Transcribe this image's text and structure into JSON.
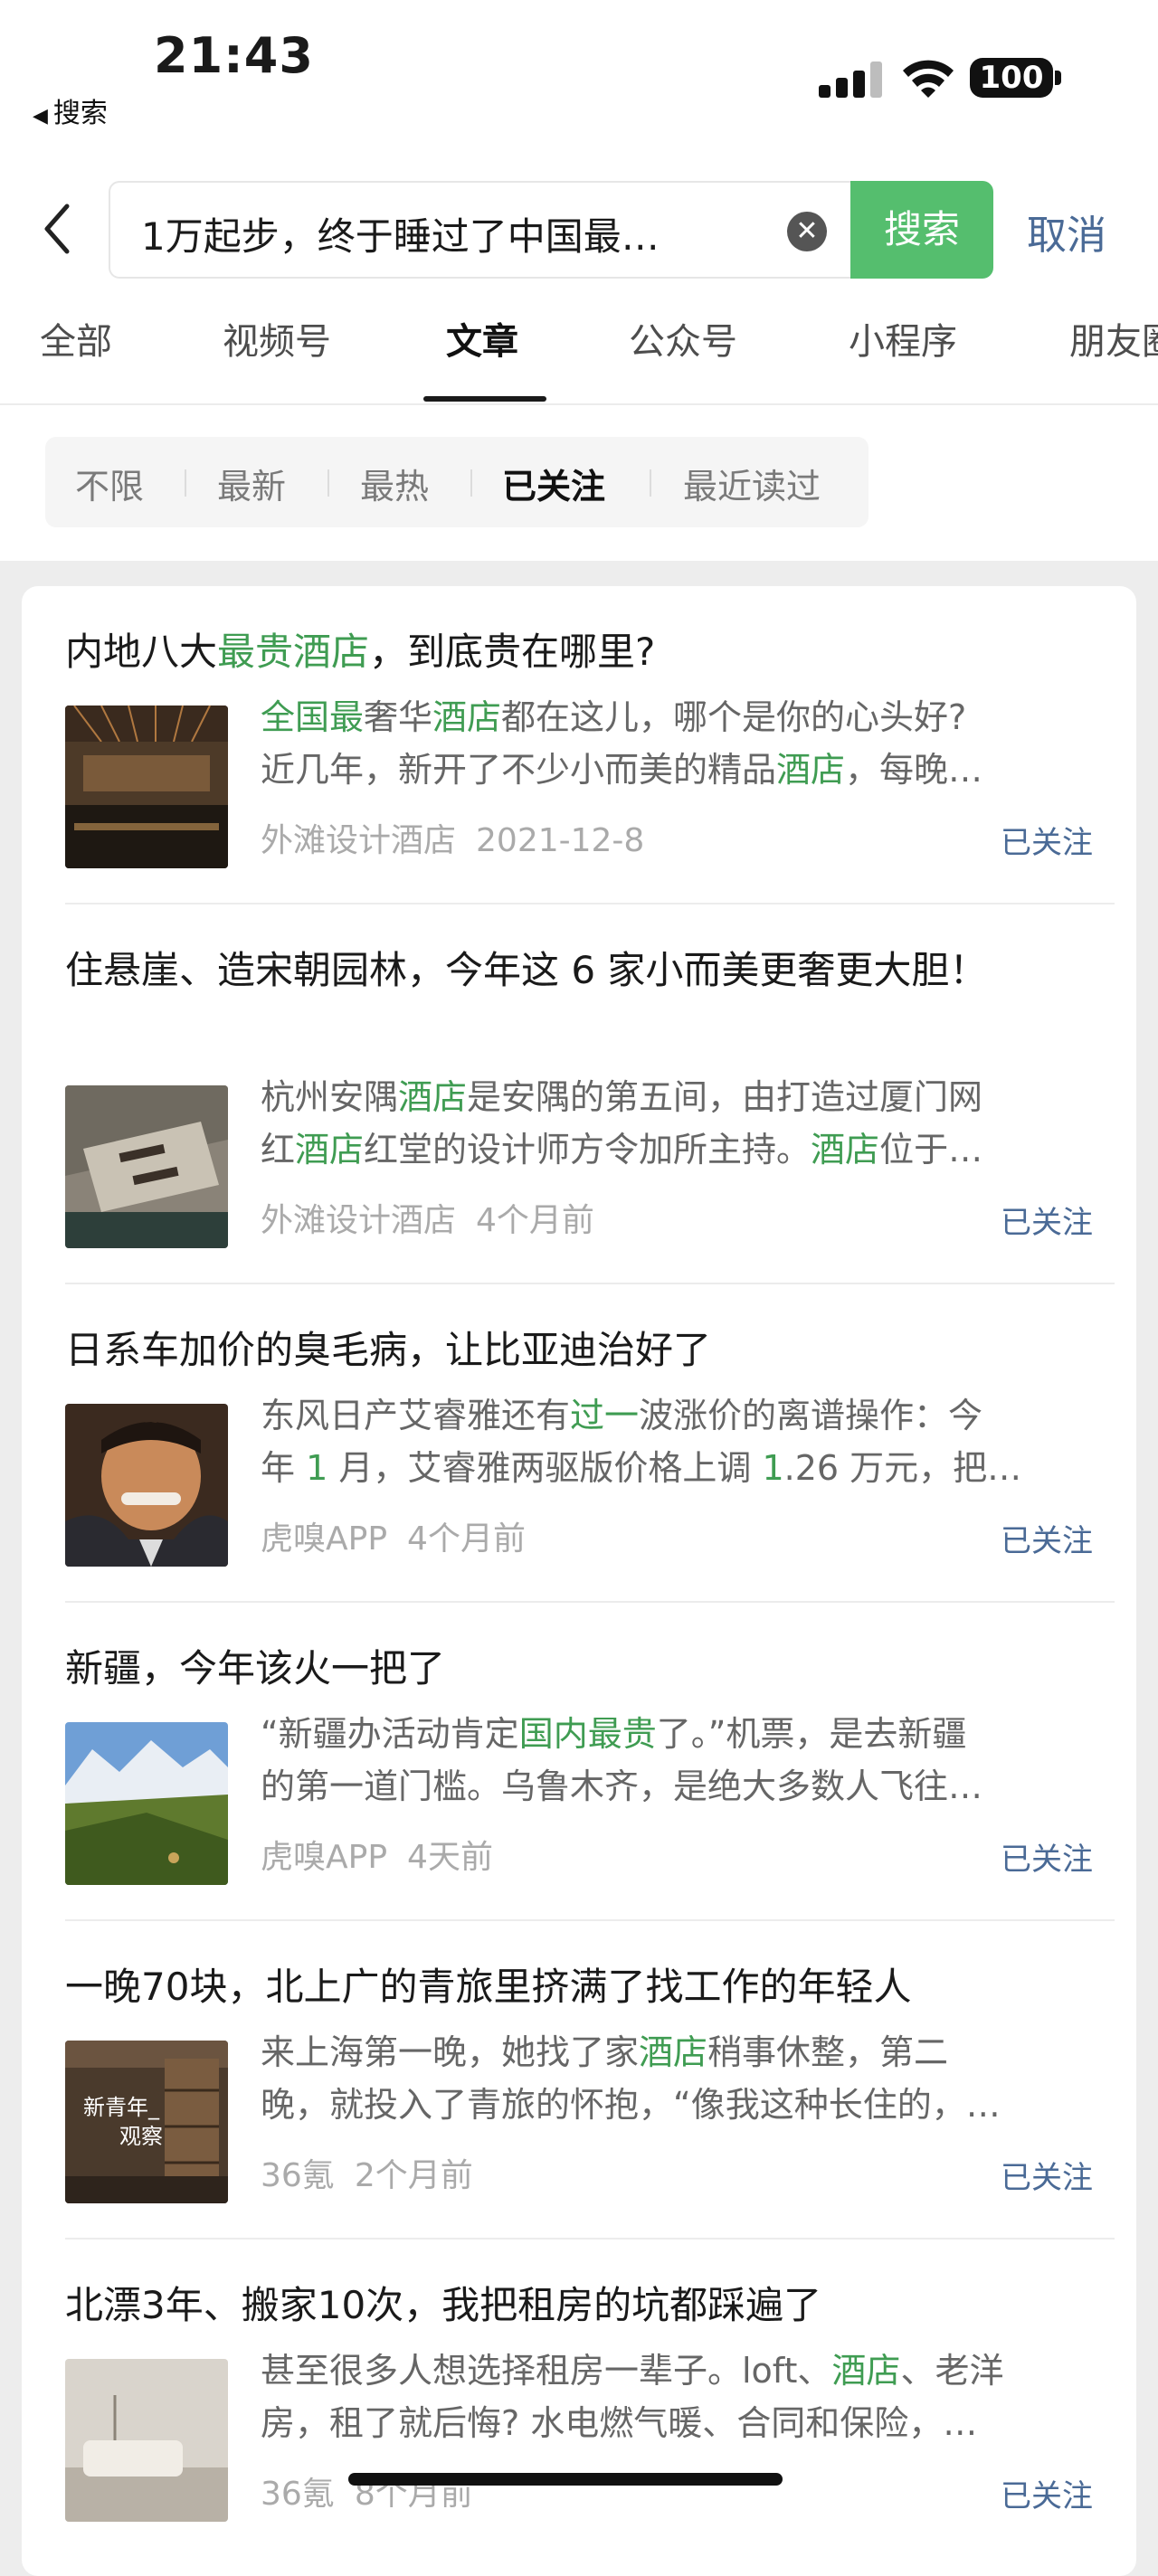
{
  "status": {
    "time": "21:43",
    "back_app": "搜索",
    "battery": "100"
  },
  "search": {
    "query": "1万起步，终于睡过了中国最…",
    "button": "搜索",
    "cancel": "取消"
  },
  "tabs": [
    "全部",
    "视频号",
    "文章",
    "公众号",
    "小程序",
    "朋友圈"
  ],
  "active_tab": "文章",
  "filters": [
    "不限",
    "最新",
    "最热",
    "已关注",
    "最近读过"
  ],
  "active_filter": "已关注",
  "highlight_color": "#3f9c52",
  "results": [
    {
      "title_parts": [
        [
          "内地八大",
          false
        ],
        [
          "最贵酒店",
          true
        ],
        [
          "，到底贵在哪里?",
          false
        ]
      ],
      "desc_lines": [
        [
          [
            "全国最",
            true
          ],
          [
            "奢华",
            false
          ],
          [
            "酒店",
            true
          ],
          [
            "都在这儿，哪个是你的心头好?",
            false
          ]
        ],
        [
          [
            "近几年，新开了不少小而美的精品",
            false
          ],
          [
            "酒店",
            true
          ],
          [
            "，每晚…",
            false
          ]
        ]
      ],
      "source": "外滩设计酒店",
      "date": "2021-12-8",
      "follow": "已关注"
    },
    {
      "title_parts": [
        [
          "住悬崖、造宋朝园林，今年这 6 家小而美更奢更大胆！",
          false
        ]
      ],
      "desc_lines": [
        [
          [
            "杭州安隅",
            false
          ],
          [
            "酒店",
            true
          ],
          [
            "是安隅的第五间，由打造过厦门网",
            false
          ]
        ],
        [
          [
            "红",
            false
          ],
          [
            "酒店",
            true
          ],
          [
            "红堂的设计师方令加所主持。",
            false
          ],
          [
            "酒店",
            true
          ],
          [
            "位于…",
            false
          ]
        ]
      ],
      "source": "外滩设计酒店",
      "date": "4个月前",
      "follow": "已关注"
    },
    {
      "title_parts": [
        [
          "日系车加价的臭毛病，让比亚迪治好了",
          false
        ]
      ],
      "desc_lines": [
        [
          [
            "东风日产艾睿雅还有",
            false
          ],
          [
            "过一",
            true
          ],
          [
            "波涨价的离谱操作：今",
            false
          ]
        ],
        [
          [
            "年 ",
            false
          ],
          [
            "1",
            true
          ],
          [
            " 月，艾睿雅两驱版价格上调 ",
            false
          ],
          [
            "1",
            true
          ],
          [
            ".26 万元，把…",
            false
          ]
        ]
      ],
      "source": "虎嗅APP",
      "date": "4个月前",
      "follow": "已关注"
    },
    {
      "title_parts": [
        [
          "新疆，今年该火一把了",
          false
        ]
      ],
      "desc_lines": [
        [
          [
            "“新疆办活动肯定",
            false
          ],
          [
            "国内最贵",
            true
          ],
          [
            "了。”机票，是去新疆",
            false
          ]
        ],
        [
          [
            "的第一道门槛。乌鲁木齐，是绝大多数人飞往…",
            false
          ]
        ]
      ],
      "source": "虎嗅APP",
      "date": "4天前",
      "follow": "已关注"
    },
    {
      "title_parts": [
        [
          "一晚70块，北上广的青旅里挤满了找工作的年轻人",
          false
        ]
      ],
      "desc_lines": [
        [
          [
            "来上海第一晚，她找了家",
            false
          ],
          [
            "酒店",
            true
          ],
          [
            "稍事休整，第二",
            false
          ]
        ],
        [
          [
            "晚，就投入了青旅的怀抱，“像我这种长住的，…",
            false
          ]
        ]
      ],
      "source": "36氪",
      "date": "2个月前",
      "follow": "已关注",
      "thumb_text": [
        "新青年_",
        "观察"
      ]
    },
    {
      "title_parts": [
        [
          "北漂3年、搬家10次，我把租房的坑都踩遍了",
          false
        ]
      ],
      "desc_lines": [
        [
          [
            "甚至很多人想选择租房一辈子。loft、",
            false
          ],
          [
            "酒店",
            true
          ],
          [
            "、老洋",
            false
          ]
        ],
        [
          [
            "房，租了就后悔? 水电燃气暖、合同和保险，…",
            false
          ]
        ]
      ],
      "source": "36氪",
      "date": "8个月前",
      "follow": "已关注"
    }
  ]
}
